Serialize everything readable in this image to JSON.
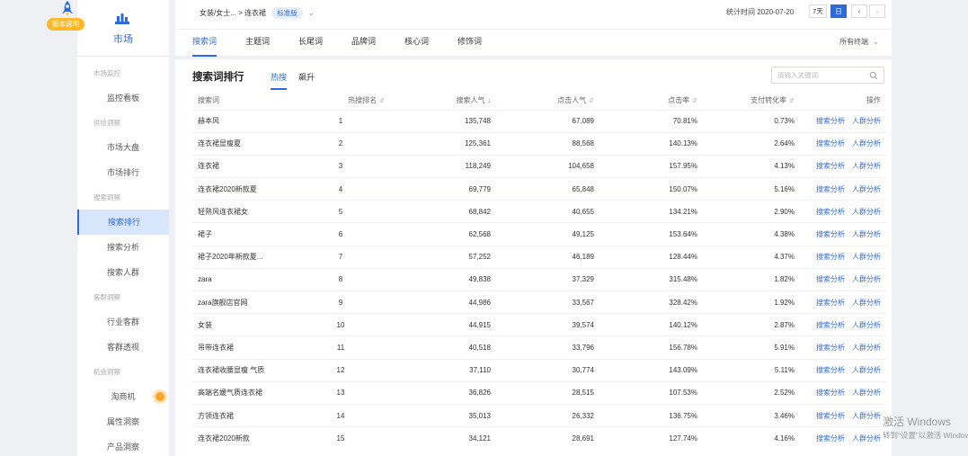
{
  "version_badge": "版本说明",
  "sidebar": {
    "title": "市场",
    "groups": [
      {
        "label": "市场监控",
        "items": [
          "监控看板"
        ]
      },
      {
        "label": "供给洞察",
        "items": [
          "市场大盘",
          "市场排行"
        ]
      },
      {
        "label": "搜索洞察",
        "items": [
          "搜索排行",
          "搜索分析",
          "搜索人群"
        ]
      },
      {
        "label": "客群洞察",
        "items": [
          "行业客群",
          "客群透视"
        ]
      },
      {
        "label": "机会洞察",
        "items": [
          "淘商机",
          "属性洞察",
          "产品洞察"
        ]
      }
    ]
  },
  "header": {
    "breadcrumb": "女装/女士... > 连衣裙",
    "edition_tag": "标准版",
    "stat_time": "统计时间 2020-07-20",
    "date_buttons": {
      "seven_day": "7天",
      "day": "日",
      "prev": "‹",
      "next": "›"
    },
    "tabs": [
      "搜索词",
      "主题词",
      "长尾词",
      "品牌词",
      "核心词",
      "修饰词"
    ],
    "filter": "所有终端"
  },
  "card": {
    "title": "搜索词排行",
    "subtabs": [
      "热搜",
      "飙升"
    ],
    "search_placeholder": "请输入关键词",
    "columns": [
      "搜索词",
      "热搜排名",
      "搜索人气",
      "点击人气",
      "点击率",
      "支付转化率",
      "操作"
    ],
    "action_labels": [
      "搜索分析",
      "人群分析"
    ],
    "rows": [
      [
        "赫本风",
        "1",
        "135,748",
        "67,089",
        "70.81%",
        "0.73%"
      ],
      [
        "连衣裙显瘦夏",
        "2",
        "125,361",
        "88,568",
        "140.13%",
        "2.64%"
      ],
      [
        "连衣裙",
        "3",
        "118,249",
        "104,658",
        "157.95%",
        "4.13%"
      ],
      [
        "连衣裙2020新款夏",
        "4",
        "69,779",
        "65,848",
        "150.07%",
        "5.16%"
      ],
      [
        "轻熟风连衣裙女",
        "5",
        "68,842",
        "40,655",
        "134.21%",
        "2.90%"
      ],
      [
        "裙子",
        "6",
        "62,568",
        "49,125",
        "153.64%",
        "4.38%"
      ],
      [
        "裙子2020年新款夏...",
        "7",
        "57,252",
        "46,189",
        "128.44%",
        "4.37%"
      ],
      [
        "zara",
        "8",
        "49,838",
        "37,329",
        "315.48%",
        "1.82%"
      ],
      [
        "zara旗舰店官网",
        "9",
        "44,986",
        "33,567",
        "328.42%",
        "1.92%"
      ],
      [
        "女装",
        "10",
        "44,915",
        "39,574",
        "140.12%",
        "2.87%"
      ],
      [
        "吊带连衣裙",
        "11",
        "40,518",
        "33,796",
        "156.78%",
        "5.91%"
      ],
      [
        "连衣裙收腰显瘦 气质",
        "12",
        "37,110",
        "30,774",
        "143.09%",
        "5.11%"
      ],
      [
        "高端名媛气质连衣裙",
        "13",
        "36,826",
        "28,515",
        "107.53%",
        "2.52%"
      ],
      [
        "方领连衣裙",
        "14",
        "35,013",
        "26,332",
        "136.75%",
        "3.46%"
      ],
      [
        "连衣裙2020新款",
        "15",
        "34,121",
        "28,691",
        "127.74%",
        "4.16%"
      ]
    ]
  },
  "watermark": {
    "title": "激活 Windows",
    "subtitle": "转到“设置”以激活 Windows。"
  },
  "colors": {
    "accent": "#2f6bd8",
    "badge": "#ffb829",
    "highlight": "#d7e6fb"
  }
}
